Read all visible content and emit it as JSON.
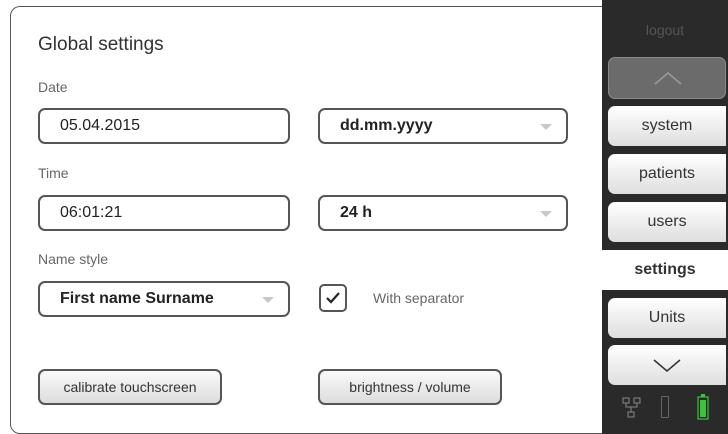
{
  "page": {
    "title": "Global settings"
  },
  "date": {
    "label": "Date",
    "value": "05.04.2015",
    "format": "dd.mm.yyyy"
  },
  "time": {
    "label": "Time",
    "value": "06:01:21",
    "format": "24 h"
  },
  "name_style": {
    "label": "Name style",
    "value": "First name Surname",
    "separator_label": "With separator",
    "separator_checked": true
  },
  "buttons": {
    "calibrate": "calibrate touchscreen",
    "brightness": "brightness / volume"
  },
  "sidebar": {
    "logout": "logout",
    "items": [
      {
        "label": "system"
      },
      {
        "label": "patients"
      },
      {
        "label": "users"
      },
      {
        "label": "settings",
        "active": true
      },
      {
        "label": "Units"
      }
    ],
    "status_icons": [
      "network-icon",
      "device-slot-icon",
      "battery-icon"
    ]
  },
  "colors": {
    "sidebar_bg": "#2a2a2a",
    "battery": "#3cc23c",
    "border": "#555555"
  }
}
